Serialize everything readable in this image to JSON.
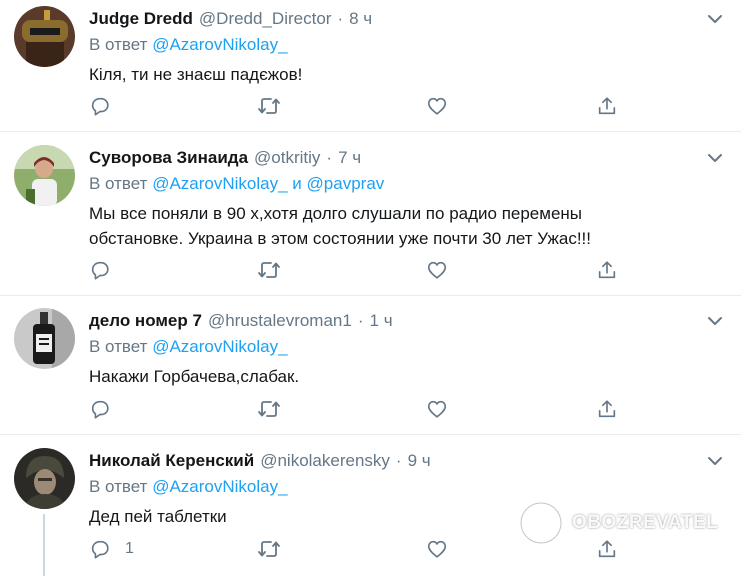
{
  "tweets": [
    {
      "name": "Judge Dredd",
      "handle": "@Dredd_Director",
      "separator": "·",
      "time": "8 ч",
      "reply_prefix": "В ответ",
      "reply_to": [
        "@AzarovNikolay_"
      ],
      "reply_joiner": "",
      "body": "Кіля, ти не знаєш падєжов!",
      "reply_count": ""
    },
    {
      "name": "Суворова Зинаида",
      "handle": "@otkritiy",
      "separator": "·",
      "time": "7 ч",
      "reply_prefix": "В ответ",
      "reply_to": [
        "@AzarovNikolay_",
        "@pavprav"
      ],
      "reply_joiner": "и",
      "body_lines": [
        "Мы все поняли в 90 х,хотя долго слушали по радио перемены",
        "обстановке. Украина в этом состоянии уже почти 30 лет Ужас!!!"
      ],
      "reply_count": ""
    },
    {
      "name": "дело номер 7",
      "handle": "@hrustalevroman1",
      "separator": "·",
      "time": "1 ч",
      "reply_prefix": "В ответ",
      "reply_to": [
        "@AzarovNikolay_"
      ],
      "reply_joiner": "",
      "body": "Накажи Горбачева,слабак.",
      "reply_count": ""
    },
    {
      "name": "Николай Керенский",
      "handle": "@nikolakerensky",
      "separator": "·",
      "time": "9 ч",
      "reply_prefix": "В ответ",
      "reply_to": [
        "@AzarovNikolay_"
      ],
      "reply_joiner": "",
      "body": "Дед пей таблетки",
      "reply_count": "1"
    }
  ],
  "watermark": {
    "text": "OBOZREVATEL"
  },
  "icons": {
    "reply": "reply-icon",
    "retweet": "retweet-icon",
    "like": "heart-icon",
    "share": "share-icon",
    "more": "chevron-down-icon"
  },
  "colors": {
    "link": "#1da1f2",
    "muted": "#657786",
    "text": "#14171a",
    "divider": "#e6ecf0"
  }
}
